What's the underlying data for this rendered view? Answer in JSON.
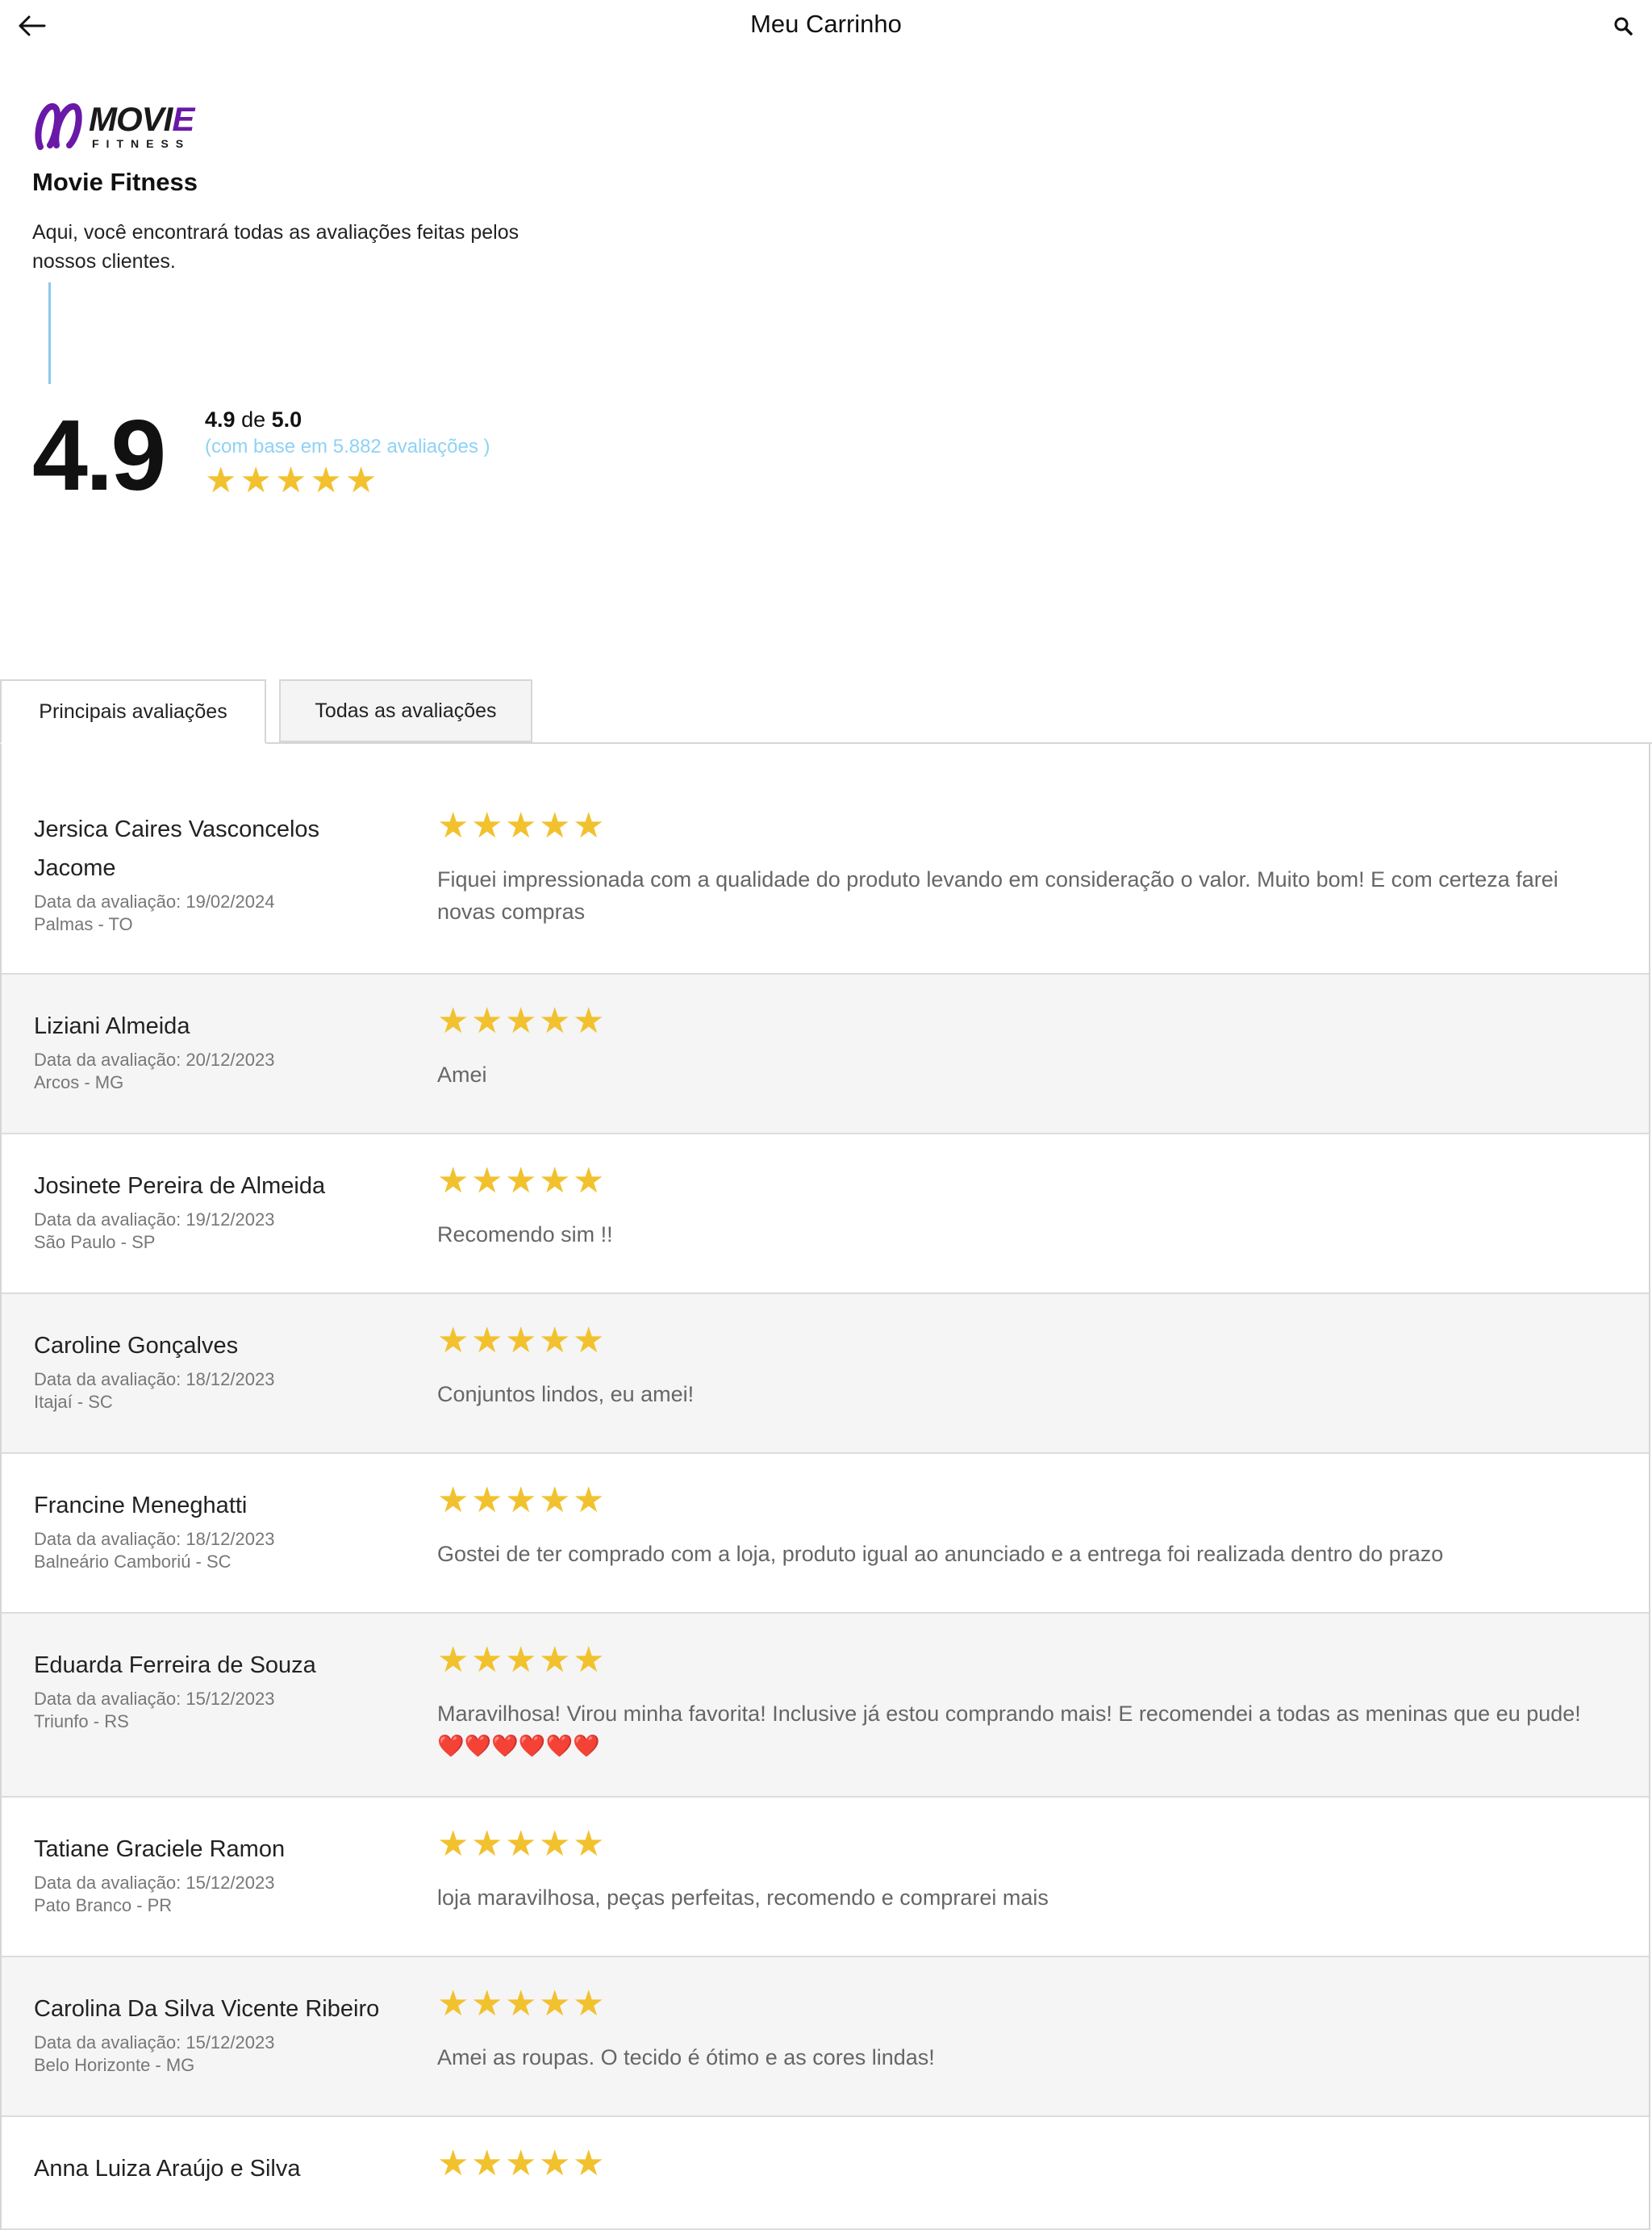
{
  "topbar": {
    "title": "Meu Carrinho",
    "back_icon": "arrow-left-icon",
    "search_icon": "search-icon"
  },
  "store": {
    "logo_word_main": "MOVI",
    "logo_word_accent": "E",
    "logo_sub": "FITNESS",
    "name": "Movie Fitness",
    "description": "Aqui, você encontrará todas as avaliações feitas pelos nossos clientes."
  },
  "summary": {
    "score": "4.9",
    "score_value": "4.9",
    "score_of": "de",
    "score_max": "5.0",
    "base_text": "(com base em 5.882 avaliações )",
    "stars": 5
  },
  "tabs": {
    "main": "Principais avaliações",
    "all": "Todas as avaliações"
  },
  "reviews": [
    {
      "name": "Jersica Caires Vasconcelos Jacome",
      "date": "Data da avaliação: 19/02/2024",
      "location": "Palmas - TO",
      "rating": 5,
      "text": "Fiquei impressionada com a qualidade do produto levando em consideração o valor. Muito bom! E com certeza farei novas compras"
    },
    {
      "name": "Liziani Almeida",
      "date": "Data da avaliação: 20/12/2023",
      "location": "Arcos - MG",
      "rating": 5,
      "text": "Amei"
    },
    {
      "name": "Josinete Pereira de Almeida",
      "date": "Data da avaliação: 19/12/2023",
      "location": "São Paulo - SP",
      "rating": 5,
      "text": "Recomendo sim !!"
    },
    {
      "name": "Caroline Gonçalves",
      "date": "Data da avaliação: 18/12/2023",
      "location": "Itajaí - SC",
      "rating": 5,
      "text": "Conjuntos lindos, eu amei!"
    },
    {
      "name": "Francine Meneghatti",
      "date": "Data da avaliação: 18/12/2023",
      "location": "Balneário Camboriú - SC",
      "rating": 5,
      "text": "Gostei de ter comprado com a loja, produto igual ao anunciado e a entrega foi realizada dentro do prazo"
    },
    {
      "name": "Eduarda Ferreira de Souza",
      "date": "Data da avaliação: 15/12/2023",
      "location": "Triunfo - RS",
      "rating": 5,
      "text": "Maravilhosa! Virou minha favorita! Inclusive já estou comprando mais! E recomendei a todas as meninas que eu pude! ❤️❤️❤️❤️❤️❤️"
    },
    {
      "name": "Tatiane Graciele Ramon",
      "date": "Data da avaliação: 15/12/2023",
      "location": "Pato Branco - PR",
      "rating": 5,
      "text": "loja maravilhosa, peças perfeitas, recomendo e comprarei mais"
    },
    {
      "name": "Carolina Da Silva Vicente Ribeiro",
      "date": "Data da avaliação: 15/12/2023",
      "location": "Belo Horizonte - MG",
      "rating": 5,
      "text": "Amei as roupas. O tecido é ótimo e as cores lindas!"
    },
    {
      "name": "Anna Luiza Araújo e Silva",
      "date": "",
      "location": "",
      "rating": 5,
      "text": ""
    }
  ],
  "colors": {
    "star": "#f2c12e",
    "accent_line": "#8fc8ee",
    "base_text": "#8ed2f5",
    "brand_purple": "#6a18a8"
  }
}
